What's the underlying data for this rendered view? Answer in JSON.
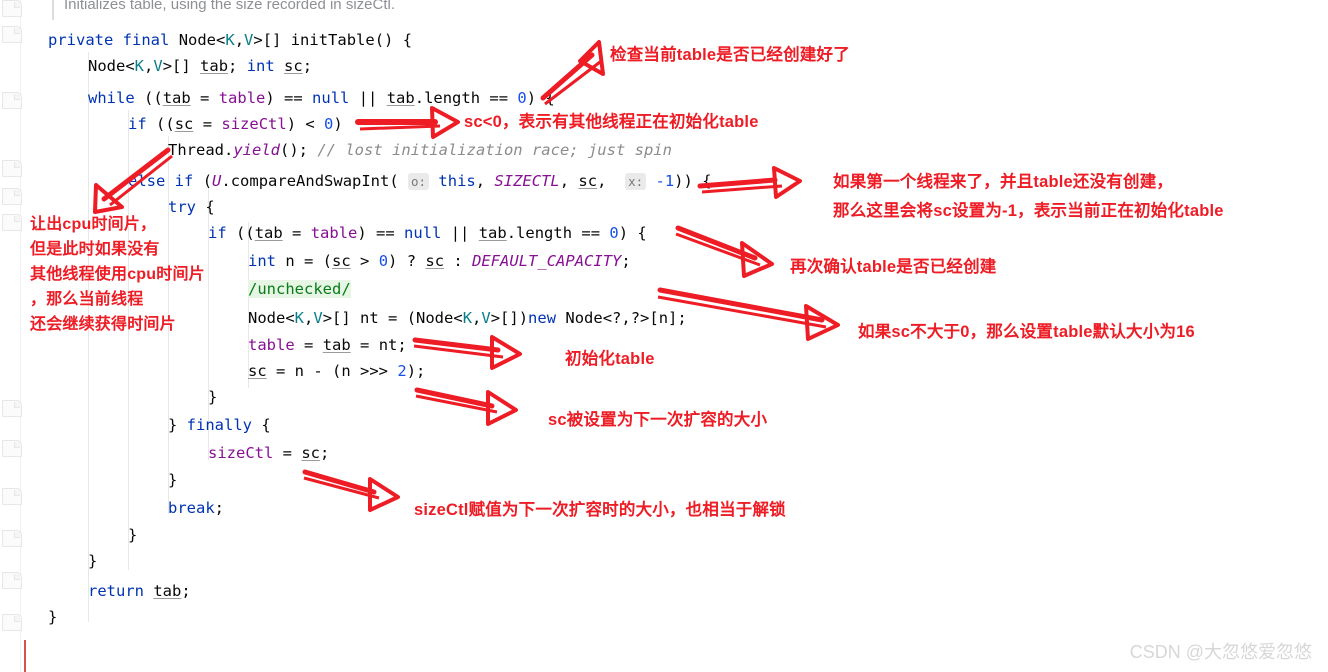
{
  "editor": {
    "doc_hint": "Initializes table, using the size recorded in sizeCtl.",
    "language": "java",
    "method_name": "initTable",
    "code_lines": [
      {
        "indent": 0,
        "text": "private final Node<K,V>[] initTable() {"
      },
      {
        "indent": 1,
        "text": "Node<K,V>[] tab; int sc;"
      },
      {
        "indent": 1,
        "text": "while ((tab = table) == null || tab.length == 0) {"
      },
      {
        "indent": 2,
        "text": "if ((sc = sizeCtl) < 0)"
      },
      {
        "indent": 3,
        "text": "Thread.yield(); // lost initialization race; just spin"
      },
      {
        "indent": 2,
        "text": "else if (U.compareAndSwapInt( o: this, SIZECTL, sc,  x: -1)) {"
      },
      {
        "indent": 3,
        "text": "try {"
      },
      {
        "indent": 3,
        "text": "if ((tab = table) == null || tab.length == 0) {"
      },
      {
        "indent": 4,
        "text": "int n = (sc > 0) ? sc : DEFAULT_CAPACITY;"
      },
      {
        "indent": 4,
        "text": "/unchecked/"
      },
      {
        "indent": 4,
        "text": "Node<K,V>[] nt = (Node<K,V>[])new Node<?,?>[n];"
      },
      {
        "indent": 4,
        "text": "table = tab = nt;"
      },
      {
        "indent": 4,
        "text": "sc = n - (n >>> 2);"
      },
      {
        "indent": 3,
        "text": "}"
      },
      {
        "indent": 2,
        "text": "} finally {"
      },
      {
        "indent": 3,
        "text": "sizeCtl = sc;"
      },
      {
        "indent": 2,
        "text": "}"
      },
      {
        "indent": 2,
        "text": "break;"
      },
      {
        "indent": 1,
        "text": "}"
      },
      {
        "indent": 1,
        "text": "}"
      },
      {
        "indent": 1,
        "text": "return tab;"
      },
      {
        "indent": 0,
        "text": "}"
      }
    ],
    "parameter_hints": [
      {
        "label": "o:",
        "value": "this"
      },
      {
        "label": "x:",
        "value": "-1"
      }
    ],
    "highlighted_token": "/unchecked/"
  },
  "annotations": [
    {
      "id": "check-table-created",
      "text": "检查当前table是否已经创建好了"
    },
    {
      "id": "sc-less-than-zero",
      "text": "sc<0，表示有其他线程正在初始化table"
    },
    {
      "id": "first-thread-cas",
      "line1": "如果第一个线程来了，并且table还没有创建，",
      "line2": "那么这里会将sc设置为-1，表示当前正在初始化table"
    },
    {
      "id": "yield-cpu-slice",
      "line1": "让出cpu时间片，",
      "line2": "但是此时如果没有",
      "line3": "其他线程使用cpu时间片",
      "line4": "，那么当前线程",
      "line5": "还会继续获得时间片"
    },
    {
      "id": "recheck-table",
      "text": "再次确认table是否已经创建"
    },
    {
      "id": "default-capacity-16",
      "text": "如果sc不大于0，那么设置table默认大小为16"
    },
    {
      "id": "init-table",
      "text": "初始化table"
    },
    {
      "id": "sc-next-resize",
      "text": "sc被设置为下一次扩容的大小"
    },
    {
      "id": "sizectl-assign-unlock",
      "text": "sizeCtl赋值为下一次扩容时的大小，也相当于解锁"
    }
  ],
  "watermark": {
    "text": "CSDN @大忽悠爱忽悠"
  },
  "colors": {
    "annotation_red": "#ee1c25",
    "keyword_blue": "#0033b3",
    "type_teal": "#0a7d8c",
    "field_purple": "#871094",
    "number_blue": "#1750eb",
    "comment_gray": "#8c8c8c",
    "unchecked_green": "#067d17",
    "unchecked_bg": "#e7f5e4",
    "watermark_gray": "#d7d7d7",
    "background": "#ffffff"
  }
}
